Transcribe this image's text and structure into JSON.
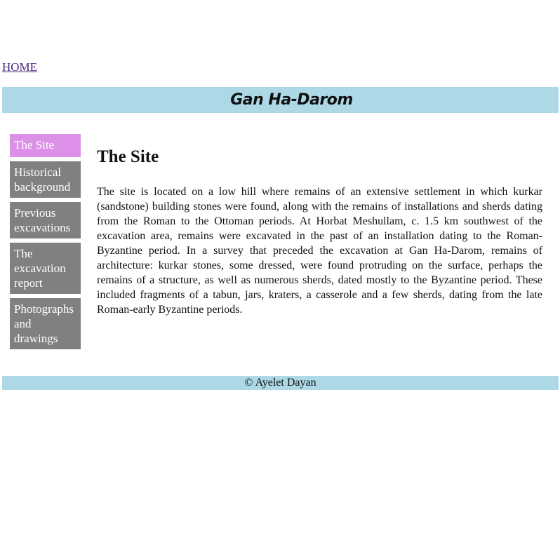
{
  "nav": {
    "home_label": "HOME"
  },
  "header": {
    "title": "Gan Ha-Darom"
  },
  "sidebar": {
    "items": [
      {
        "label": "The Site",
        "active": true
      },
      {
        "label": "Historical background",
        "active": false
      },
      {
        "label": "Previous excavations",
        "active": false
      },
      {
        "label": "The excavation report",
        "active": false
      },
      {
        "label": "Photographs and drawings",
        "active": false
      }
    ]
  },
  "main": {
    "heading": "The Site",
    "paragraph": "The site is located on a low hill where remains of an extensive settlement in which kurkar (sandstone) building stones were found, along with the remains of installations and sherds dating from the Roman to the Ottoman periods. At Horbat Meshullam, c. 1.5 km southwest of the excavation area, remains were excavated in the past of an installation dating to the Roman-Byzantine period. In a survey that preceded the excavation at Gan Ha-Darom, remains of architecture: kurkar stones, some dressed, were found protruding on the surface, perhaps the remains of a structure, as well as numerous sherds, dated mostly to the Byzantine period. These included fragments of a tabun, jars, kraters, a casserole and a few sherds, dating from the late Roman-early Byzantine periods."
  },
  "footer": {
    "text": "© Ayelet Dayan"
  },
  "colors": {
    "banner_bg": "#add8e6",
    "nav_bg": "#808080",
    "nav_active_bg": "#dd90e8",
    "link": "#4b2a7a"
  }
}
